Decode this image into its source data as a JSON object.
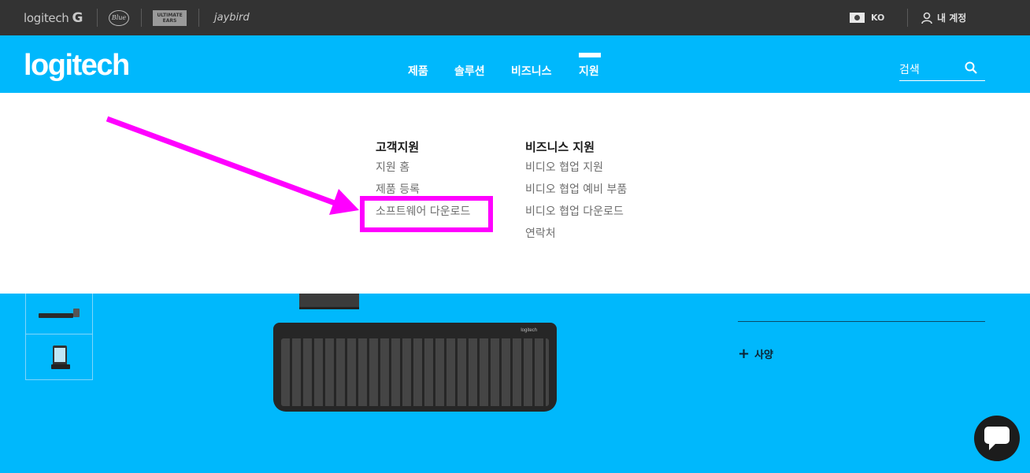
{
  "topbar": {
    "brands": {
      "logitech": "logitech",
      "logitech_g": "G",
      "blue": "Blue",
      "ue_line1": "ULTIMATE",
      "ue_line2": "EARS",
      "jaybird": "jaybird"
    },
    "locale_code": "KO",
    "account_label": "내 계정"
  },
  "header": {
    "logo": "logitech",
    "nav": [
      "제품",
      "솔루션",
      "비즈니스",
      "지원"
    ],
    "active_nav": "지원",
    "search_placeholder": "검색"
  },
  "dropdown": {
    "customer_support": {
      "heading": "고객지원",
      "links": [
        "지원 홈",
        "제품 등록",
        "소프트웨어 다운로드"
      ]
    },
    "business_support": {
      "heading": "비즈니스 지원",
      "links": [
        "비디오 협업 지원",
        "비디오 협업 예비 부품",
        "비디오 협업 다운로드",
        "연락처"
      ]
    }
  },
  "hero": {
    "specs_label": "사양",
    "keyboard_brand": "logitech"
  },
  "annotation": {
    "highlighted_link": "소프트웨어 다운로드",
    "color": "#ff00ff"
  },
  "colors": {
    "brand_blue": "#00b8fc",
    "topbar_bg": "#333333",
    "dropdown_bg": "#ffffff"
  }
}
